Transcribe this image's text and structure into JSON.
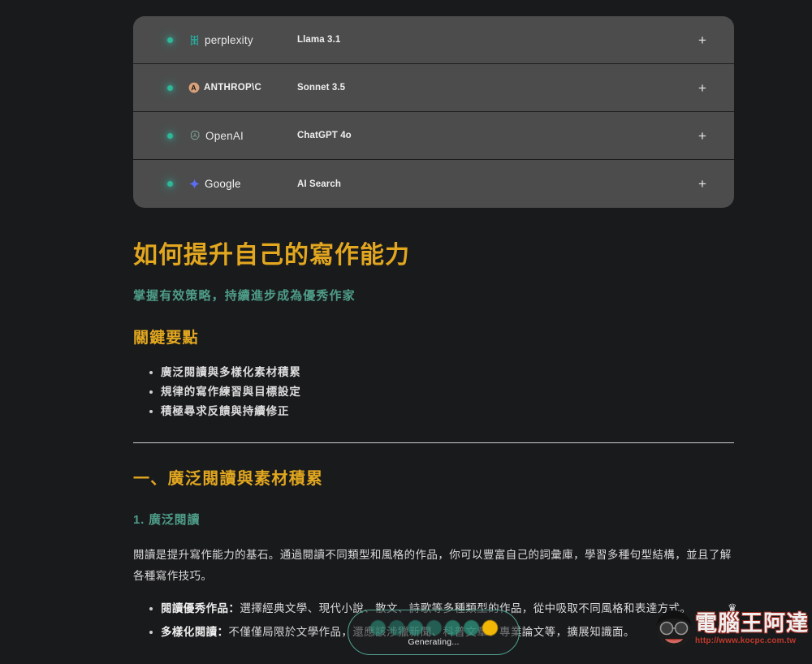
{
  "model_selector": {
    "rows": [
      {
        "status": "active",
        "brand": "perplexity",
        "brand_logo": "perplexity-logo-icon",
        "model": "Llama 3.1",
        "add_label": "+"
      },
      {
        "status": "active",
        "brand": "ANTHROP\\C",
        "brand_logo": "anthropic-logo-icon",
        "model": "Sonnet 3.5",
        "add_label": "+"
      },
      {
        "status": "active",
        "brand": "OpenAI",
        "brand_logo": "openai-logo-icon",
        "model": "ChatGPT 4o",
        "add_label": "+"
      },
      {
        "status": "active",
        "brand": "Google",
        "brand_logo": "google-gemini-sparkle-icon",
        "model": "AI Search",
        "add_label": "+"
      }
    ]
  },
  "article": {
    "title": "如何提升自己的寫作能力",
    "subtitle": "掌握有效策略，持續進步成為優秀作家",
    "keypoints_heading": "關鍵要點",
    "keypoints": [
      "廣泛閱讀與多樣化素材積累",
      "規律的寫作練習與目標設定",
      "積極尋求反饋與持續修正"
    ],
    "section_heading": "一、廣泛閱讀與素材積累",
    "subsection_heading": "1. 廣泛閱讀",
    "paragraph": "閱讀是提升寫作能力的基石。通過閱讀不同類型和風格的作品，你可以豐富自己的詞彙庫，學習多種句型結構，並且了解各種寫作技巧。",
    "bullets": [
      {
        "lead": "閱讀優秀作品：",
        "text": "選擇經典文學、現代小說、散文、詩歌等多種類型的作品，從中吸取不同風格和表達方式。"
      },
      {
        "lead": "多樣化閱讀：",
        "text": "不僅僅局限於文學作品，還應該涉獵新聞、科普文章、專業論文等，擴展知識面。"
      }
    ]
  },
  "status_overlay": {
    "label": "Generating...",
    "dot_count": 7,
    "dots": [
      {
        "color": "#2e9e86",
        "opacity": 0.55
      },
      {
        "color": "#2e9e86",
        "opacity": 0.45
      },
      {
        "color": "#2e9e86",
        "opacity": 0.6
      },
      {
        "color": "#2e9e86",
        "opacity": 0.5
      },
      {
        "color": "#2e9e86",
        "opacity": 0.65
      },
      {
        "color": "#2e9e86",
        "opacity": 0.7
      },
      {
        "color": "#f2b705",
        "opacity": 1.0
      }
    ]
  },
  "watermark": {
    "title": "電腦王阿達",
    "url": "http://www.kocpc.com.tw",
    "crown": "♕"
  },
  "colors": {
    "page_bg": "#191a1c",
    "card_bg": "#4c4c4c",
    "gold": "#e2a71f",
    "teal": "#4e9c88",
    "status_dot": "#2fb79a",
    "body_text": "#dadada",
    "watermark_red": "#c0392b"
  }
}
